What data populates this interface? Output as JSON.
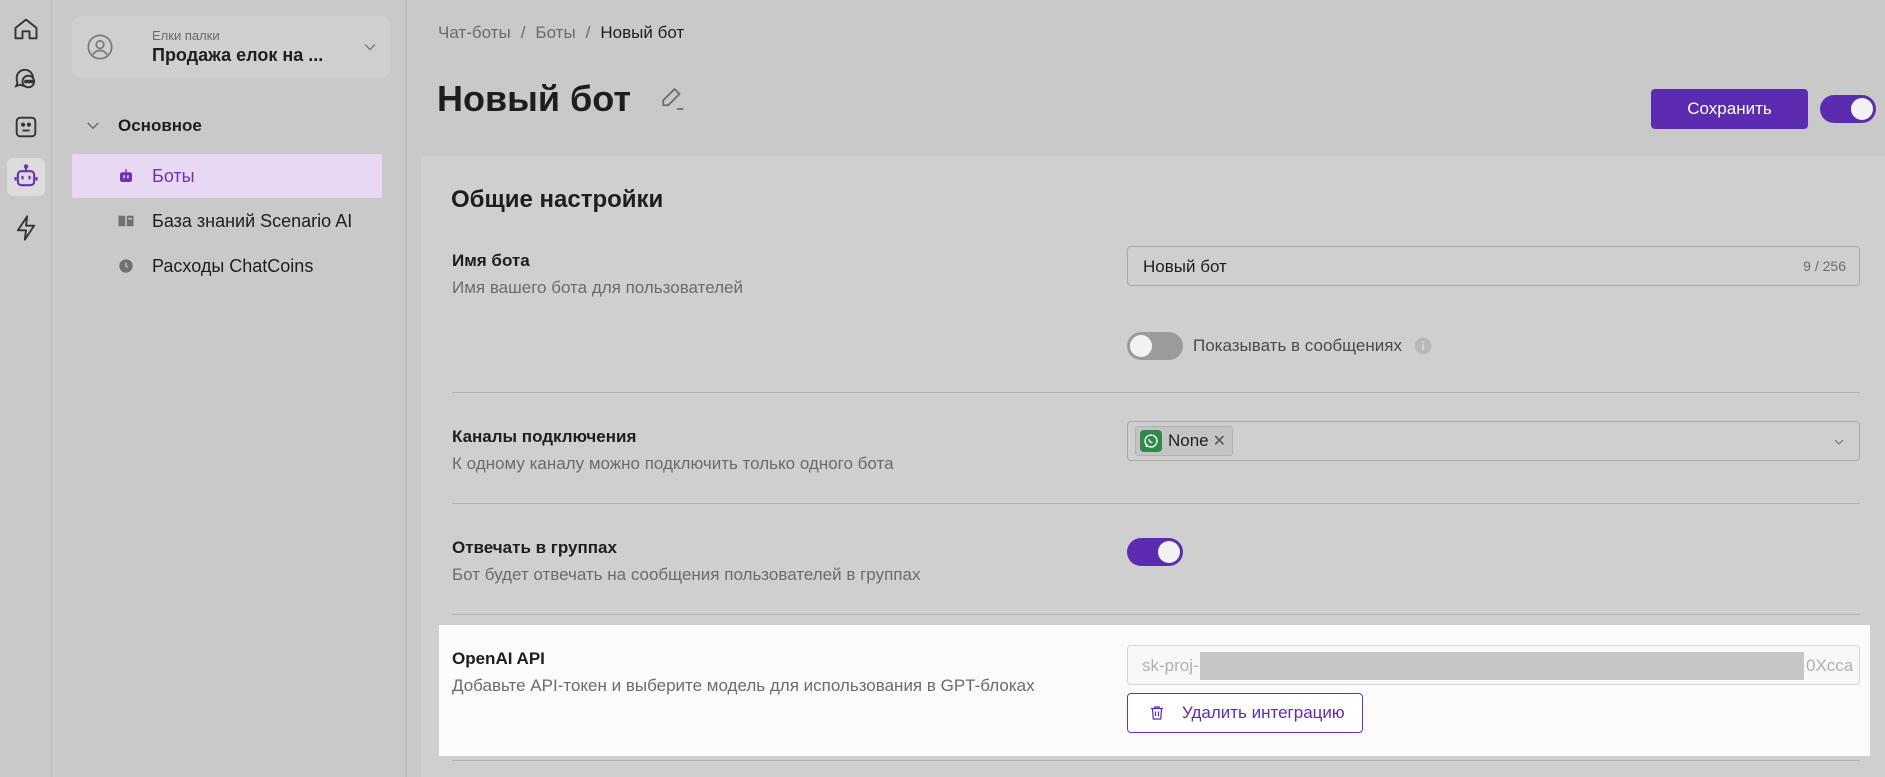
{
  "rail": {
    "items": [
      "home-icon",
      "chat-icon",
      "bot-face-icon",
      "bot-icon",
      "lightning-icon"
    ]
  },
  "org": {
    "label": "Елки палки",
    "name": "Продажа елок на ..."
  },
  "nav": {
    "group": "Основное",
    "items": [
      {
        "label": "Боты",
        "icon": "bot-icon"
      },
      {
        "label": "База знаний Scenario AI",
        "icon": "book-icon"
      },
      {
        "label": "Расходы ChatCoins",
        "icon": "coin-icon"
      }
    ]
  },
  "breadcrumb": {
    "items": [
      "Чат-боты",
      "/",
      "Боты",
      "/",
      "Новый бот"
    ]
  },
  "page": {
    "title": "Новый бот",
    "save_label": "Сохранить",
    "active": true
  },
  "settings": {
    "section_title": "Общие настройки",
    "bot_name": {
      "label": "Имя бота",
      "desc": "Имя вашего бота для пользователей",
      "value": "Новый бот",
      "count": "9 / 256",
      "show_in_messages_label": "Показывать в сообщениях",
      "show_in_messages": false
    },
    "channels": {
      "label": "Каналы подключения",
      "desc": "К одному каналу можно подключить только одного бота",
      "selected": "None",
      "remove_glyph": "✕"
    },
    "groups": {
      "label": "Отвечать в группах",
      "desc": "Бот будет отвечать на сообщения пользователей в группах",
      "enabled": true
    },
    "openai": {
      "label": "OpenAI API",
      "desc": "Добавьте API-токен и выберите модель для использования в GPT-блоках",
      "token_prefix": "sk-proj-",
      "token_suffix": "0Xcca",
      "delete_label": "Удалить интеграцию"
    }
  },
  "colors": {
    "accent": "#5b2bb0",
    "active_nav_bg": "#e9d8f4",
    "background": "#c9c9c9",
    "highlight_block": "#fafbfa"
  }
}
